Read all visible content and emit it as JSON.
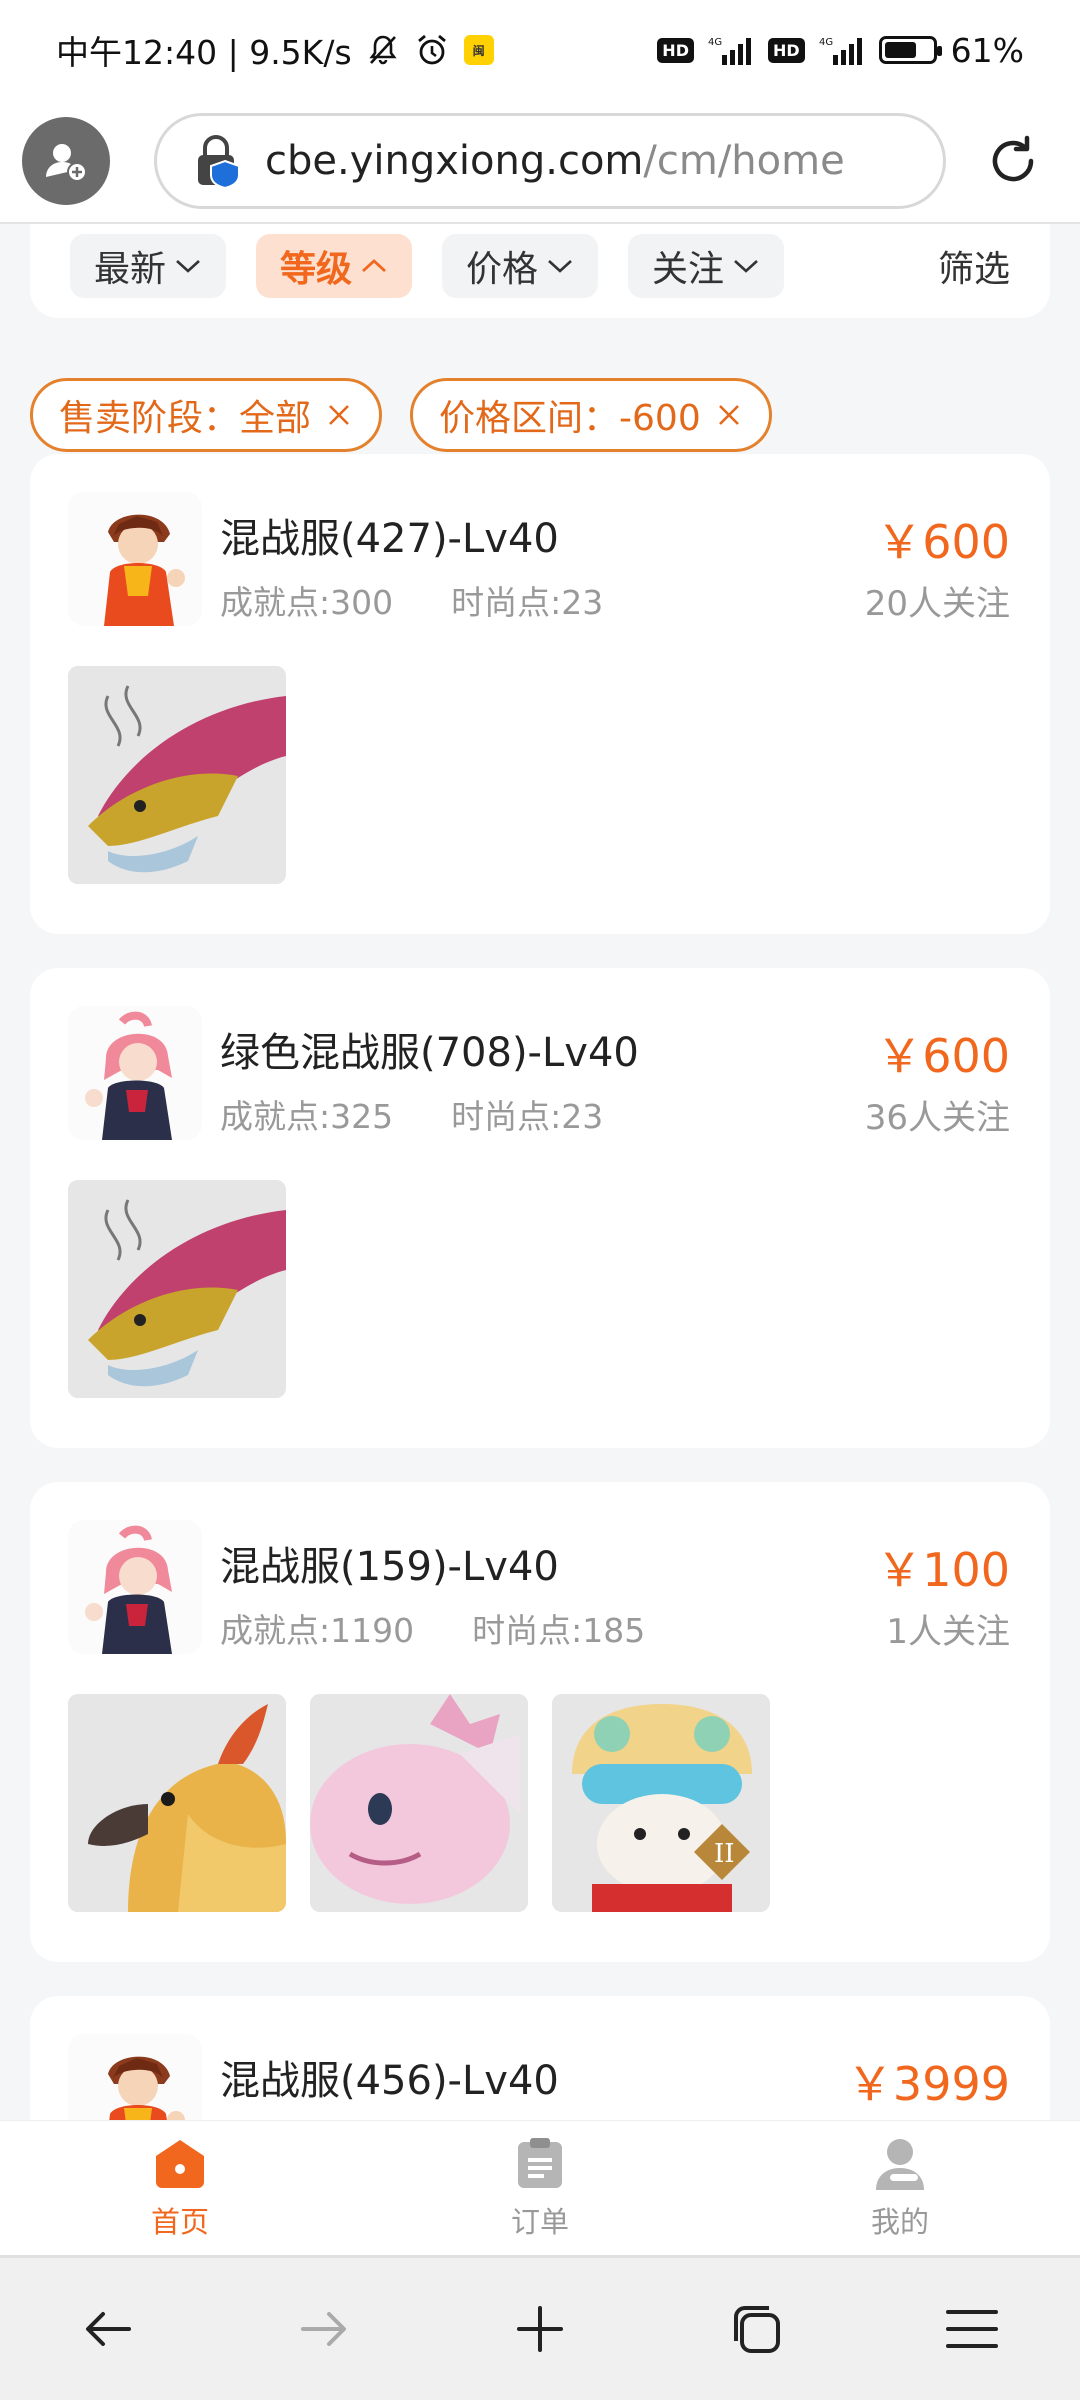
{
  "status": {
    "time_speed": "中午12:40 | 9.5K/s",
    "net_badge": "闽",
    "hd1": "HD",
    "hd2": "HD",
    "battery_pct": "61%",
    "battery_level": 0.61
  },
  "browser": {
    "url_domain": "cbe.yingxiong.com",
    "url_path": "/cm/home"
  },
  "sort": {
    "items": [
      {
        "label": "最新",
        "active": false
      },
      {
        "label": "等级",
        "active": true
      },
      {
        "label": "价格",
        "active": false
      },
      {
        "label": "关注",
        "active": false
      }
    ],
    "filter_label": "筛选"
  },
  "tags": [
    {
      "label": "售卖阶段：全部"
    },
    {
      "label": "价格区间：-600"
    }
  ],
  "listings": [
    {
      "title": "混战服(427)-Lv40",
      "achievement": "成就点:300",
      "fashion": "时尚点:23",
      "price": "￥600",
      "followers": "20人关注",
      "avatar": "male-hero",
      "thumbs": [
        "dragon"
      ]
    },
    {
      "title": "绿色混战服(708)-Lv40",
      "achievement": "成就点:325",
      "fashion": "时尚点:23",
      "price": "￥600",
      "followers": "36人关注",
      "avatar": "female-hero",
      "thumbs": [
        "dragon"
      ]
    },
    {
      "title": "混战服(159)-Lv40",
      "achievement": "成就点:1190",
      "fashion": "时尚点:185",
      "price": "￥100",
      "followers": "1人关注",
      "avatar": "female-hero",
      "thumbs": [
        "phoenix",
        "pink-creature",
        "lion-costume"
      ]
    },
    {
      "title": "混战服(456)-Lv40",
      "price": "￥3999",
      "avatar": "male-hero"
    }
  ],
  "tabbar": {
    "items": [
      {
        "label": "首页",
        "active": true,
        "icon": "home-icon"
      },
      {
        "label": "订单",
        "active": false,
        "icon": "clipboard-icon"
      },
      {
        "label": "我的",
        "active": false,
        "icon": "user-icon"
      }
    ]
  },
  "colors": {
    "accent": "#f0671d",
    "tag_border": "#e3812d",
    "muted": "#999999"
  }
}
